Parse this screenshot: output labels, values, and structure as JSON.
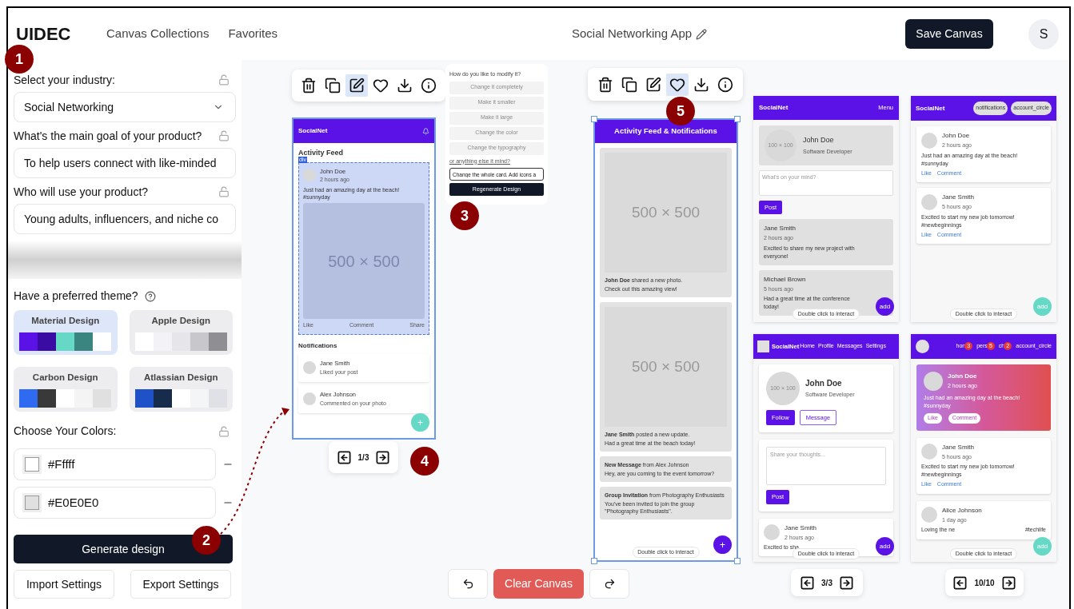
{
  "header": {
    "logo": "UIDEC",
    "nav": [
      "Canvas Collections",
      "Favorites"
    ],
    "project_title": "Social Networking App",
    "save_button": "Save Canvas",
    "avatar": "S"
  },
  "sidebar": {
    "fields": [
      {
        "kind": "select",
        "label": "Select your industry:",
        "value": "Social Networking"
      },
      {
        "kind": "input",
        "label": "What's the main goal of your product?",
        "value": "To help users connect with like-minded"
      },
      {
        "kind": "input",
        "label": "Who will use your product?",
        "value": "Young adults, influencers, and niche co"
      }
    ],
    "theme_label": "Have a preferred theme?",
    "themes": [
      {
        "name": "Material Design",
        "selected": true,
        "swatches": [
          {
            "color": "#5b12e6"
          },
          {
            "color": "#3a0ca3"
          },
          {
            "color": "#66d9c6"
          },
          {
            "color": "#3a857f"
          },
          {
            "color": "#ffffff"
          }
        ]
      },
      {
        "name": "Apple Design",
        "selected": false,
        "swatches": [
          {
            "color": "#ffffff"
          },
          {
            "color": "#f2f2f7"
          },
          {
            "color": "#e5e5ea"
          },
          {
            "color": "#c7c7cc"
          },
          {
            "color": "#8e8e93"
          }
        ]
      },
      {
        "name": "Carbon Design",
        "selected": false,
        "swatches": [
          {
            "color": "#2f6bf0"
          },
          {
            "color": "#393939"
          },
          {
            "color": "#ffffff"
          },
          {
            "color": "#f4f4f4"
          },
          {
            "color": "#e0e0e0"
          }
        ]
      },
      {
        "name": "Atlassian Design",
        "selected": false,
        "swatches": [
          {
            "color": "#1f52c8"
          },
          {
            "color": "#172b4d"
          },
          {
            "color": "#ffffff"
          },
          {
            "color": "#f4f5f7"
          },
          {
            "color": "#dfe1e6"
          }
        ]
      }
    ],
    "colors_label": "Choose Your Colors:",
    "colors": [
      {
        "value": "#Fffff",
        "color": "#ffffff"
      },
      {
        "value": "#E0E0E0",
        "color": "#e0e0e0"
      }
    ],
    "generate_button": "Generate design",
    "import_button": "Import Settings",
    "export_button": "Export Settings"
  },
  "annotations": [
    "1",
    "2",
    "3",
    "4",
    "5"
  ],
  "canvas": {
    "selected_design": {
      "toolbar": [
        {
          "kind": "delete",
          "selected": false
        },
        {
          "kind": "duplicate",
          "selected": false
        },
        {
          "kind": "edit",
          "selected": true
        },
        {
          "kind": "favorite",
          "selected": false
        },
        {
          "kind": "download",
          "selected": false
        },
        {
          "kind": "info",
          "selected": false
        }
      ],
      "app_title": "SocialNet",
      "section_title": "Activity Feed",
      "tag": "div",
      "post": {
        "selected": true,
        "author": "John Doe",
        "time": "2 hours ago",
        "text": "Just had an amazing day at the beach! #sunnyday",
        "image": "500 × 500",
        "actions": [
          "Like",
          "Comment",
          "Share"
        ]
      },
      "notifications_title": "Notifications",
      "notifications": [
        {
          "name": "Jane Smith",
          "text": "Liked your post"
        },
        {
          "name": "Alex Johnson",
          "text": "Commented on your photo"
        }
      ],
      "fab": "+",
      "pager": "1/3"
    },
    "modify_panel": {
      "question": "How do you like to modify it?",
      "options": [
        {
          "label": "Change it completely",
          "disabled": true
        },
        {
          "label": "Make it smaller",
          "disabled": true
        },
        {
          "label": "Make it large",
          "disabled": true
        },
        {
          "label": "Change the color",
          "disabled": true
        },
        {
          "label": "Change the typography",
          "disabled": true
        }
      ],
      "prompt_label": "or anything else it mind?",
      "prompt_value": "Change the whole card. Add icons a",
      "button": "Regenerate Design"
    },
    "favorite_design": {
      "toolbar": [
        {
          "kind": "delete",
          "selected": false
        },
        {
          "kind": "duplicate",
          "selected": false
        },
        {
          "kind": "edit",
          "selected": false
        },
        {
          "kind": "favorite",
          "selected": true
        },
        {
          "kind": "download",
          "selected": false
        },
        {
          "kind": "info",
          "selected": false
        }
      ],
      "title": "Activity Feed & Notifications",
      "items": [
        {
          "kind": "photo",
          "image": "500 × 500",
          "line1": "**John Doe** shared a new photo.",
          "line2": "Check out this amazing view!"
        },
        {
          "kind": "photo",
          "image": "500 × 500",
          "line1": "**Jane Smith** posted a new update.",
          "line2": "Had a great time at the beach today!"
        },
        {
          "kind": "text",
          "line1": "**New Message** from Alex Johnson",
          "line2": "Hey, are you coming to the event tomorrow?"
        },
        {
          "kind": "text",
          "line1": "**Group Invitation** from Photography Enthusiasts",
          "line2": "You've been invited to join the group \"Photography Enthusiasts\"."
        }
      ],
      "fab": "+",
      "hint": "Double click to interact"
    },
    "variants": [
      {
        "kind": "menu",
        "app_title": "SocialNet",
        "menu": "Menu",
        "profile": {
          "avatar": "100 × 100",
          "name": "John Doe",
          "role": "Software Developer"
        },
        "placeholder": "What's on your mind?",
        "post_button": "Post",
        "posts": [
          {
            "name": "Jane Smith",
            "time": "2 hours ago",
            "text": "Excited to share my new project with everyone!"
          },
          {
            "name": "Michael Brown",
            "time": "5 hours ago",
            "text": "Had a great time at the conference today!"
          }
        ],
        "fab": "add",
        "hint": "Double click to interact"
      },
      {
        "kind": "chips",
        "app_title": "SocialNet",
        "chips": [
          "notifications",
          "account_circle"
        ],
        "posts": [
          {
            "name": "John Doe",
            "time": "2 hours ago",
            "text": "Just had an amazing day at the beach! #sunnyday",
            "actions": [
              "Like",
              "Comment"
            ]
          },
          {
            "name": "Jane Smith",
            "time": "5 hours ago",
            "text": "Excited to start my new job tomorrow! #newbeginnings",
            "actions": [
              "Like",
              "Comment"
            ]
          }
        ],
        "fab": "add",
        "hint": "Double click to interact"
      },
      {
        "kind": "nav",
        "app_title": "SocialNet",
        "nav": [
          "Home",
          "Profile",
          "Messages",
          "Settings"
        ],
        "profile": {
          "avatar": "100 × 100",
          "name": "John Doe",
          "role": "Software Developer",
          "buttons": [
            "Follow",
            "Message"
          ]
        },
        "placeholder": "Share your thoughts...",
        "post_button": "Post",
        "posts": [
          {
            "name": "Jane Smith",
            "time": "2 hours ago",
            "text": "Excited to sha"
          }
        ],
        "fab": "add",
        "hint": "Double click to interact"
      },
      {
        "kind": "badges",
        "nav": [
          {
            "label": "hon",
            "badge": "3"
          },
          {
            "label": "pers",
            "badge": "5"
          },
          {
            "label": "ch",
            "badge": "2"
          },
          {
            "label": "account_circle"
          }
        ],
        "featured": {
          "name": "John Doe",
          "time": "2 hours ago",
          "text": "Just had an amazing day at the beach! #sunnyday",
          "actions": [
            "Like",
            "Comment"
          ]
        },
        "posts": [
          {
            "name": "Jane Smith",
            "time": "5 hours ago",
            "text": "Excited to start my new job tomorrow! #newbeginnings",
            "actions": [
              "Like",
              "Comment"
            ]
          },
          {
            "name": "Alice Johnson",
            "time": "1 day ago",
            "text": "Loving the ne",
            "text_end": "#techlife"
          }
        ],
        "fab": "add",
        "hint": "Double click to interact"
      }
    ],
    "pagers": [
      "3/3",
      "10/10"
    ],
    "clear_button": "Clear Canvas"
  }
}
